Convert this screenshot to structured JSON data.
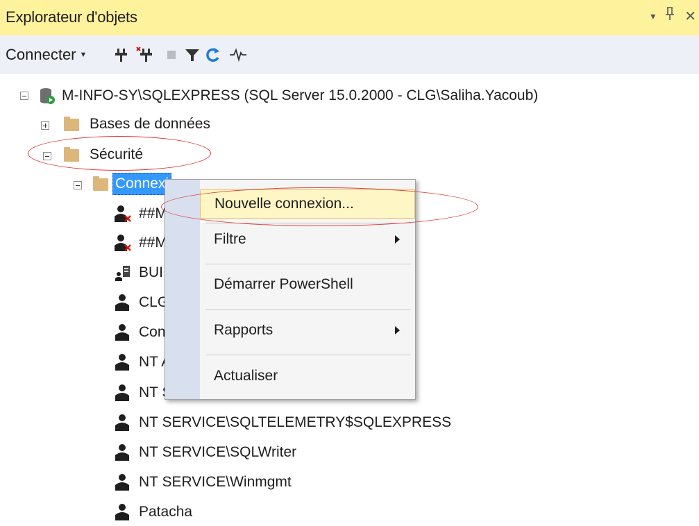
{
  "titlebar": {
    "title": "Explorateur d'objets",
    "controls": [
      "▾",
      "⊥",
      "✕"
    ]
  },
  "toolbar": {
    "connect_label": "Connecter",
    "icons": [
      "connect-plug-icon",
      "disconnect-plug-icon",
      "stop-icon",
      "filter-icon",
      "refresh-icon",
      "activity-monitor-icon"
    ]
  },
  "tree": {
    "server": "M-INFO-SY\\SQLEXPRESS (SQL Server 15.0.2000 - CLG\\Saliha.Yacoub)",
    "databases": "Bases de données",
    "security": "Sécurité",
    "logins": "Connexi",
    "items": [
      "##M",
      "##M",
      "BUI",
      "CLG",
      "Con",
      "NT A",
      "NT S",
      "NT SERVICE\\SQLTELEMETRY$SQLEXPRESS",
      "NT SERVICE\\SQLWriter",
      "NT SERVICE\\Winmgmt",
      "Patacha"
    ]
  },
  "context_menu": {
    "items": [
      {
        "label": "Nouvelle connexion...",
        "submenu": false
      },
      {
        "label": "Filtre",
        "submenu": true
      },
      {
        "label": "Démarrer PowerShell",
        "submenu": false
      },
      {
        "label": "Rapports",
        "submenu": true
      },
      {
        "label": "Actualiser",
        "submenu": false
      }
    ]
  },
  "colors": {
    "titlebar_bg": "#fff29d",
    "toolbar_bg": "#eef0f7",
    "selection": "#3399ff",
    "annotation": "#e23b3b",
    "folder": "#dcb67a"
  }
}
